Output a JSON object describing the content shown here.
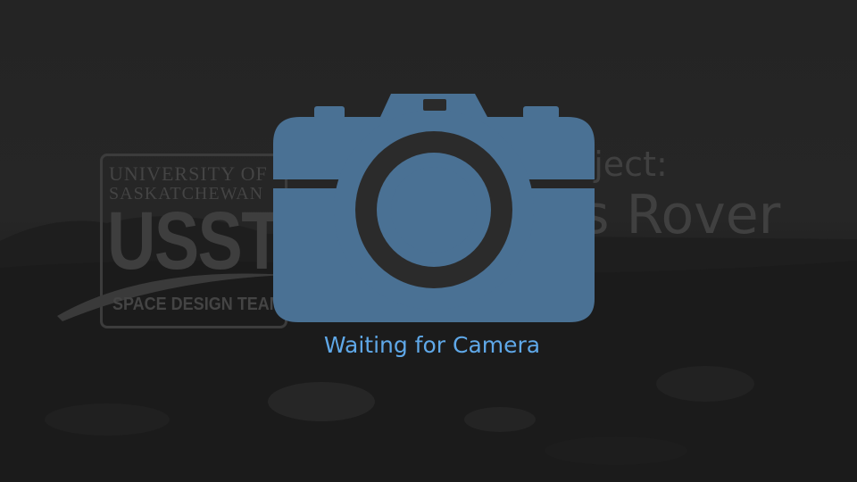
{
  "background": {
    "description_icon": "mars-terrain-background"
  },
  "logo": {
    "line1": "UNIVERSITY OF",
    "line2": "SASKATCHEWAN",
    "acronym": "USST",
    "team": "SPACE DESIGN TEAM"
  },
  "project": {
    "subtitle": "New Project:",
    "title": "Mars Rover"
  },
  "camera": {
    "icon": "camera-icon",
    "color": "#4a7194",
    "status": "Waiting for Camera",
    "status_color": "#5fa8e8"
  }
}
